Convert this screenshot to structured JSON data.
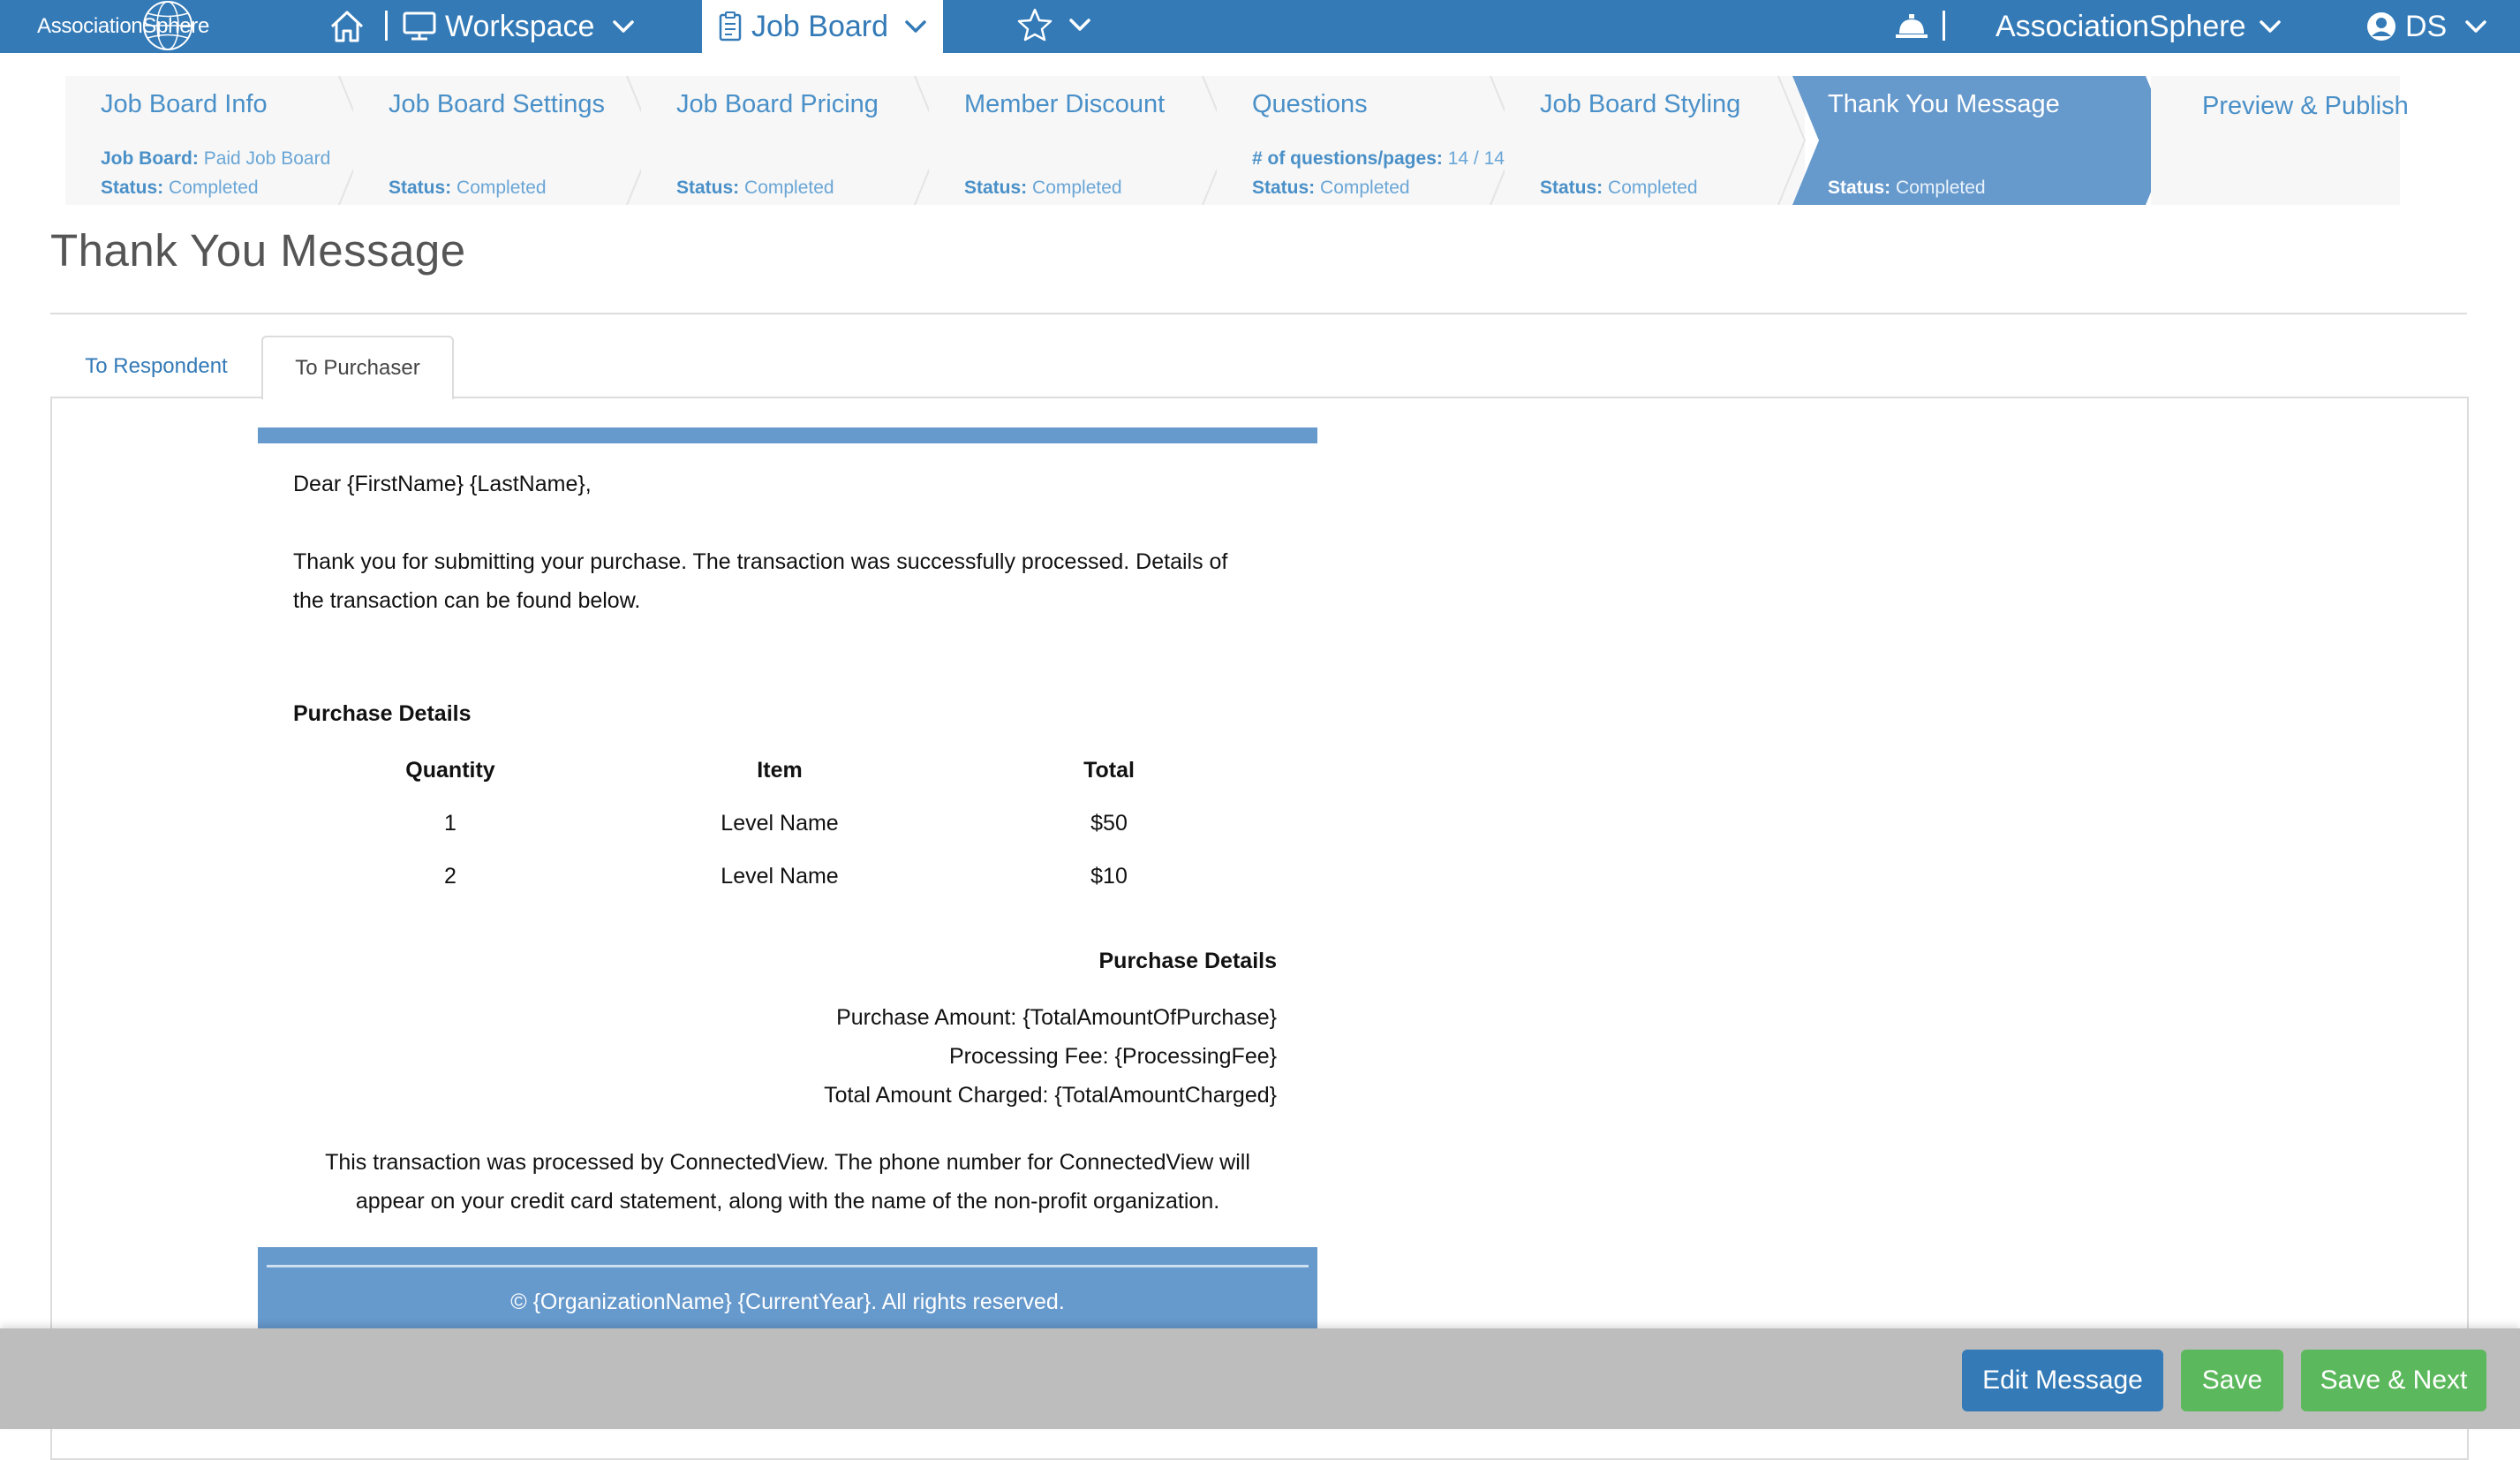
{
  "nav": {
    "logo_text": "AssociationSphere",
    "workspace": "Workspace",
    "job_board": "Job Board",
    "org": "AssociationSphere",
    "user": "DS"
  },
  "steps": [
    {
      "title": "Job Board Info",
      "lines": [
        {
          "label": "Job Board:",
          "value": "Paid Job Board"
        },
        {
          "label": "Status:",
          "value": "Completed"
        }
      ]
    },
    {
      "title": "Job Board Settings",
      "lines": [
        {
          "label": "Status:",
          "value": "Completed"
        }
      ]
    },
    {
      "title": "Job Board Pricing",
      "lines": [
        {
          "label": "Status:",
          "value": "Completed"
        }
      ]
    },
    {
      "title": "Member Discount",
      "lines": [
        {
          "label": "Status:",
          "value": "Completed"
        }
      ]
    },
    {
      "title": "Questions",
      "lines": [
        {
          "label": "# of questions/pages:",
          "value": "14 / 14"
        },
        {
          "label": "Status:",
          "value": "Completed"
        }
      ]
    },
    {
      "title": "Job Board Styling",
      "lines": [
        {
          "label": "Status:",
          "value": "Completed"
        }
      ]
    },
    {
      "title": "Thank You Message",
      "lines": [
        {
          "label": "Status:",
          "value": "Completed"
        }
      ],
      "active": true
    },
    {
      "title": "Preview & Publish",
      "lines": []
    }
  ],
  "page_title": "Thank You Message",
  "tabs": {
    "respondent": "To Respondent",
    "purchaser": "To Purchaser"
  },
  "email": {
    "greeting": "Dear {FirstName} {LastName},",
    "intro_line1": "Thank you for submitting your purchase. The transaction was successfully processed. Details of",
    "intro_line2": "the transaction can be found below.",
    "purchase_details_heading": "Purchase Details",
    "table": {
      "headers": [
        "Quantity",
        "Item",
        "Total"
      ],
      "rows": [
        [
          "1",
          "Level Name",
          "$50"
        ],
        [
          "2",
          "Level Name",
          "$10"
        ]
      ]
    },
    "summary_heading": "Purchase Details",
    "purchase_amount": "Purchase Amount: {TotalAmountOfPurchase}",
    "processing_fee": "Processing Fee: {ProcessingFee}",
    "total_charged": "Total Amount Charged: {TotalAmountCharged}",
    "processor_line1": "This transaction was processed by ConnectedView. The phone number for ConnectedView will",
    "processor_line2": "appear on your credit card statement, along with the name of the non-profit organization.",
    "footer": "© {OrganizationName} {CurrentYear}. All rights reserved."
  },
  "actions": {
    "edit": "Edit Message",
    "save": "Save",
    "save_next": "Save & Next"
  },
  "colors": {
    "brand": "#337ab7",
    "active_step": "#6699cc",
    "success": "#5cb85c"
  }
}
